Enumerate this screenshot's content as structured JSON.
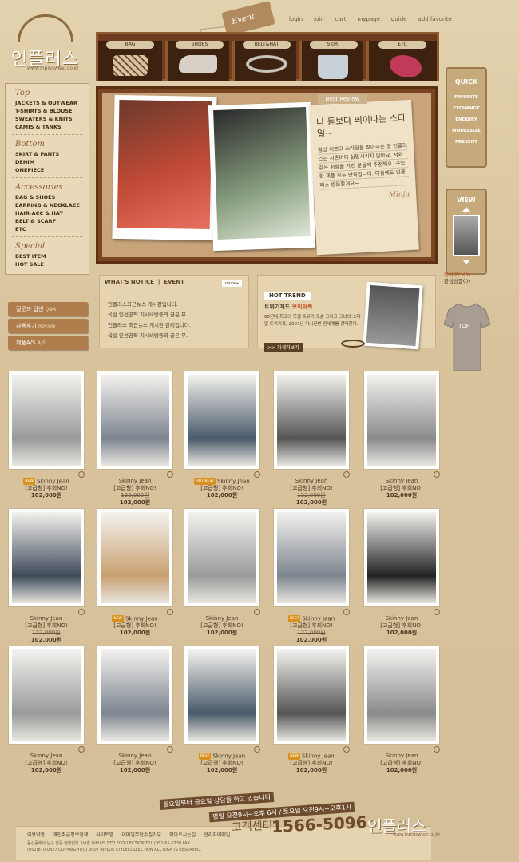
{
  "brand": {
    "logo_text": "인플러스",
    "url": "www.inpluswear.co.kr"
  },
  "topnav": [
    "login",
    "join",
    "cart",
    "mypage",
    "guide",
    "add favorite"
  ],
  "event_tag": "Event",
  "shelf": [
    "BAG",
    "SHOES",
    "BELT&HAT",
    "SKIRT",
    "ETC"
  ],
  "sidebar": {
    "sections": [
      {
        "title": "Top",
        "items": [
          "JACKETS & OUTWEAR",
          "T-SHIRTS & BLOUSE",
          "SWEATERS & KNITS",
          "CAMIS & TANKS"
        ]
      },
      {
        "title": "Bottom",
        "items": [
          "SKIRT & PANTS",
          "DENIM",
          "ONEPIECE"
        ]
      },
      {
        "title": "Accessories",
        "items": [
          "BAG & SHOES",
          "EARRING & NECKLACE",
          "HAIR-ACC & HAT",
          "BELT & SCARF",
          "ETC"
        ]
      },
      {
        "title": "Special",
        "items": [
          "BEST ITEM",
          "HOT SALE"
        ]
      }
    ],
    "buttons": [
      {
        "label": "질문과 답변",
        "sub": "Q&A"
      },
      {
        "label": "사용후기",
        "sub": "Review"
      },
      {
        "label": "제품A/S",
        "sub": "A/S"
      }
    ]
  },
  "review": {
    "tag": "Best Review",
    "title": "나 돋보다 띄이나는 스타일~",
    "body": "항상 이쁘고 스타일을 찾아주는 곳 인플러스는 시즌마다 실망시키지 않아요. 저와 같은 취향을 가진 분들께 추천해요. 구입한 제품 모두 만족합니다. 다음에도 인플러스 방문할게요~",
    "sign": "Minju"
  },
  "notice": {
    "head": "WHAT'S NOTICE",
    "tab": "EVENT",
    "more": "more ▸",
    "items": [
      "인플러스최근뉴스 게시판입니다.",
      "육설 인선공략 지시비방등의 글은 무.",
      "인플러스 최근뉴스 게시판 관리입니다.",
      "육설 인선공략 지시비방등의 글은 무."
    ]
  },
  "hottrend": {
    "head": "HOT TREND",
    "title": "트위기처드",
    "title_accent": "보이쉬룩",
    "body": "60년대 최고의 모델 트위기 포순 그리고 그녀의 스타일 트위기록, 2007년 다시한번 전세계를 강타한다.",
    "button": ">> 자세히보기"
  },
  "quick": {
    "title": "QUICK",
    "items": [
      "FAVORITE",
      "EXCHANGE",
      "ENQUIRY",
      "MODELSIZE",
      "PRESENT"
    ]
  },
  "view": {
    "title": "VIEW"
  },
  "cart_info": {
    "cart": "장바구니(0)",
    "recent": "관심상품(0)"
  },
  "tshirt_label": "TOP",
  "products": [
    {
      "name": "Skinny Jean",
      "desc": "[고급형] 후회NO!",
      "old_price": "",
      "price": "102,000원",
      "badge": "NEW",
      "tone": "#9a9a9a"
    },
    {
      "name": "Skinny Jean",
      "desc": "[고급형] 후회NO!",
      "old_price": "122,000원",
      "price": "102,000원",
      "badge": "",
      "tone": "#7d8590"
    },
    {
      "name": "Skinny Jean",
      "desc": "[고급형] 후회NO!",
      "old_price": "",
      "price": "102,000원",
      "badge": "HOT BEST",
      "tone": "#4a5a6a"
    },
    {
      "name": "Skinny Jean",
      "desc": "[고급형] 후회NO!",
      "old_price": "122,000원",
      "price": "102,000원",
      "badge": "",
      "tone": "#555555"
    },
    {
      "name": "Skinny Jean",
      "desc": "[고급형] 후회NO!",
      "old_price": "",
      "price": "102,000원",
      "badge": "",
      "tone": "#8a8a8a"
    },
    {
      "name": "Skinny Jean",
      "desc": "[고급형] 후회NO!",
      "old_price": "122,000원",
      "price": "102,000원",
      "badge": "",
      "tone": "#3e4a5a"
    },
    {
      "name": "Skinny Jean",
      "desc": "[고급형] 후회NO!",
      "old_price": "",
      "price": "102,000원",
      "badge": "NEW",
      "tone": "#c8a070"
    },
    {
      "name": "Skinny Jean",
      "desc": "[고급형] 후회NO!",
      "old_price": "",
      "price": "102,000원",
      "badge": "",
      "tone": "#9a9a9a"
    },
    {
      "name": "Skinny Jean",
      "desc": "[고급형] 후회NO!",
      "old_price": "122,000원",
      "price": "102,000원",
      "badge": "BEST",
      "tone": "#7d8590"
    },
    {
      "name": "Skinny Jean",
      "desc": "[고급형] 후회NO!",
      "old_price": "",
      "price": "102,000원",
      "badge": "",
      "tone": "#222222"
    },
    {
      "name": "Skinny Jean",
      "desc": "[고급형] 후회NO!",
      "old_price": "",
      "price": "102,000원",
      "badge": "",
      "tone": "#9a9a9a"
    },
    {
      "name": "Skinny Jean",
      "desc": "[고급형] 후회NO!",
      "old_price": "",
      "price": "102,000원",
      "badge": "",
      "tone": "#7d8590"
    },
    {
      "name": "Skinny Jean",
      "desc": "[고급형] 후회NO!",
      "old_price": "",
      "price": "102,000원",
      "badge": "BEST",
      "tone": "#4a5a6a"
    },
    {
      "name": "Skinny Jean",
      "desc": "[고급형] 후회NO!",
      "old_price": "",
      "price": "102,000원",
      "badge": "NEW",
      "tone": "#555555"
    },
    {
      "name": "Skinny Jean",
      "desc": "[고급형] 후회NO!",
      "old_price": "",
      "price": "102,000원",
      "badge": "",
      "tone": "#8a8a8a"
    }
  ],
  "footer": {
    "notice1": "월요일부터 금요일 상담을 하고 있습니다",
    "notice2": "평일 오전9시~오후 6시 / 토요일 오전9시~오후1시",
    "cs_label": "고객센터",
    "phone": "1566-5096",
    "logo": "인플러스",
    "url": "www.inpluswear.co.kr",
    "links": [
      "이용약관",
      "개인취급정보정책",
      "사이트맵",
      "이메일무단수집거부",
      "찾아오시는길",
      "관리자이메일"
    ],
    "address": "동산동에서 남구 달동 현행빌딩 3/4층 INPLUS STYLECOLLECTION TEL (052)61-0738 FAX (052)870-0827 COPYRIGHT(C) 2007 INPLUS STYLECOLLECTION ALL RIGHTS RESERVED."
  },
  "colors": {
    "accent": "#8b6a3e",
    "wood": "#7a4522",
    "paper": "#efe2c7",
    "badge": "#d8901e"
  }
}
